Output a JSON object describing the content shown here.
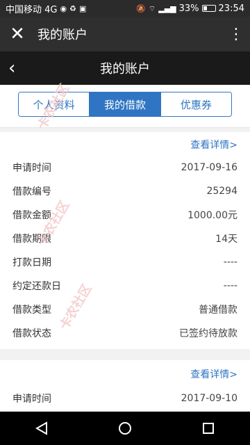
{
  "status_bar": {
    "carrier": "中国移动 4G",
    "battery": "33%",
    "battery_level": 0.33,
    "time": "23:54"
  },
  "app_bar": {
    "title": "我的账户",
    "close_icon": "close-icon",
    "more_icon": "more-vert-icon"
  },
  "page_header": {
    "title": "我的账户",
    "back_icon": "chevron-left-icon"
  },
  "tabs": [
    {
      "label": "个人资料",
      "active": false
    },
    {
      "label": "我的借款",
      "active": true
    },
    {
      "label": "优惠券",
      "active": false
    }
  ],
  "loans": [
    {
      "detail_link": "查看详情>",
      "rows": [
        {
          "label": "申请时间",
          "value": "2017-09-16"
        },
        {
          "label": "借款编号",
          "value": "25294"
        },
        {
          "label": "借款金额",
          "value": "1000.00元"
        },
        {
          "label": "借款期限",
          "value": "14天"
        },
        {
          "label": "打款日期",
          "value": "----"
        },
        {
          "label": "约定还款日",
          "value": "----"
        },
        {
          "label": "借款类型",
          "value": "普通借款"
        },
        {
          "label": "借款状态",
          "value": "已签约待放款"
        }
      ]
    },
    {
      "detail_link": "查看详情>",
      "rows": [
        {
          "label": "申请时间",
          "value": "2017-09-10"
        }
      ]
    }
  ],
  "watermark": "卡农社区",
  "colors": {
    "accent": "#2f75c3",
    "app_bar": "#2f2f2f",
    "page_header": "#1a1a1a"
  }
}
